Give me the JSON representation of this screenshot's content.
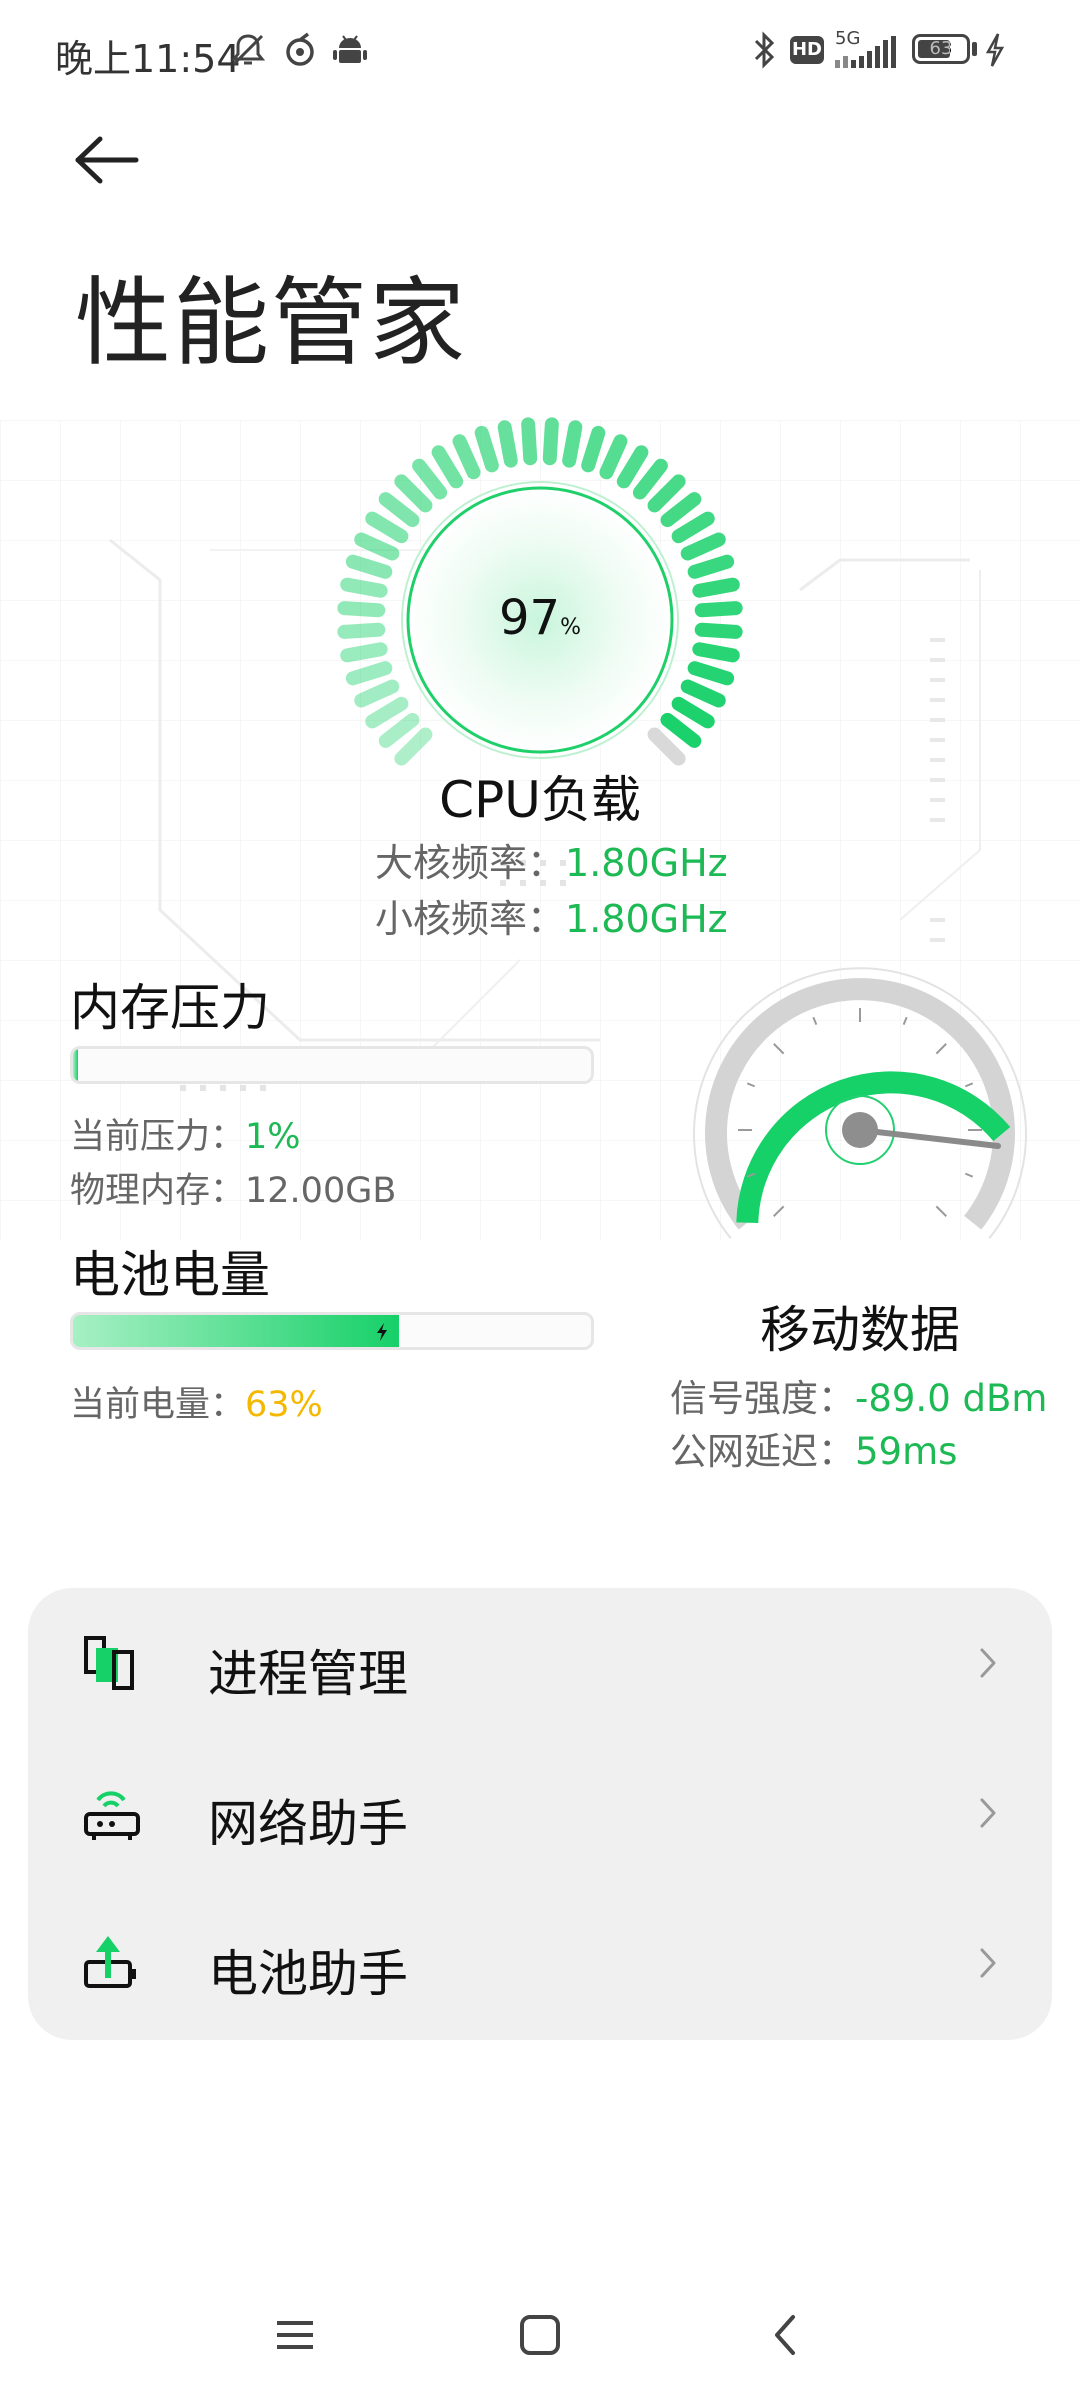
{
  "status_bar": {
    "time": "晚上11:54",
    "network": "5G",
    "hd_badge": "HD",
    "battery_level": "63",
    "icons": [
      "mute-bell-icon",
      "vpn-icon",
      "android-icon",
      "bluetooth-icon",
      "hd-icon",
      "signal-icon",
      "battery-icon",
      "charging-icon"
    ]
  },
  "header": {
    "title": "性能管家"
  },
  "cpu": {
    "percent": "97",
    "percent_unit": "%",
    "label": "CPU负载",
    "big_core_label": "大核频率：",
    "big_core_value": "1.80GHz",
    "small_core_label": "小核频率：",
    "small_core_value": "1.80GHz",
    "load_fraction": 0.97
  },
  "memory": {
    "title": "内存压力",
    "pressure_label": "当前压力：",
    "pressure_value": "1%",
    "pressure_fraction": 0.01,
    "physical_label": "物理内存：",
    "physical_value": "12.00GB"
  },
  "battery": {
    "title": "电池电量",
    "level_label": "当前电量：",
    "level_value": "63%",
    "level_fraction": 0.63
  },
  "mobile_data": {
    "title": "移动数据",
    "signal_label": "信号强度：",
    "signal_value": "-89.0 dBm",
    "latency_label": "公网延迟：",
    "latency_value": "59ms"
  },
  "menu": {
    "items": [
      {
        "label": "进程管理",
        "icon": "process-icon"
      },
      {
        "label": "网络助手",
        "icon": "router-icon"
      },
      {
        "label": "电池助手",
        "icon": "battery-charge-icon"
      }
    ]
  },
  "nav_bar": {
    "icons": [
      "menu-icon",
      "home-icon",
      "back-icon"
    ]
  },
  "colors": {
    "accent_green": "#1db954",
    "battery_yellow": "#f5b800",
    "gauge_green": "#16d068"
  }
}
